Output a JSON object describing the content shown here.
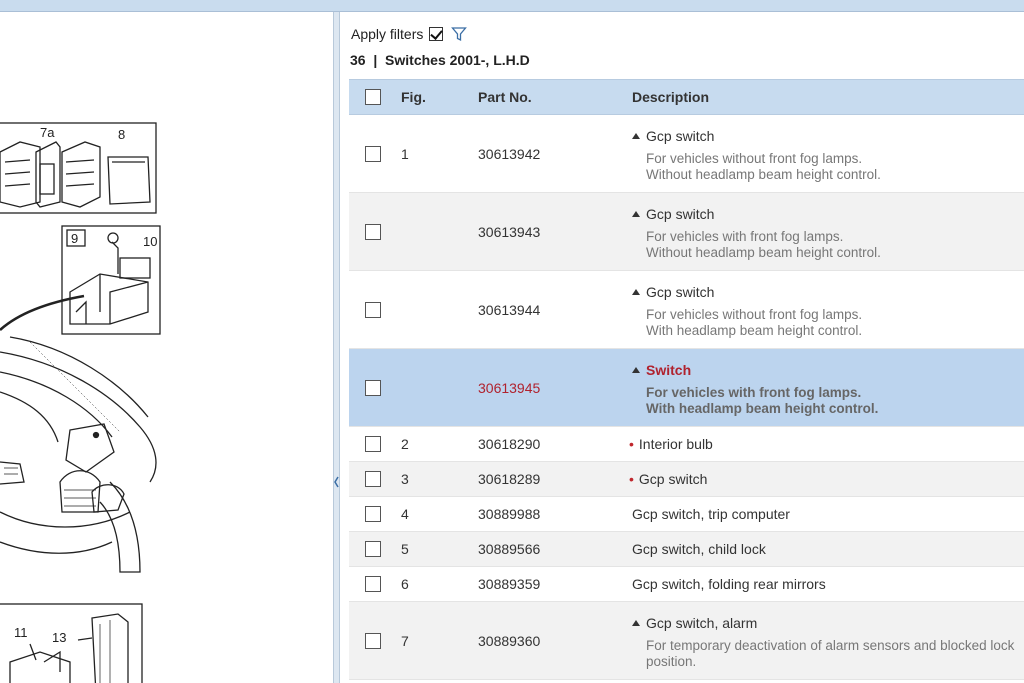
{
  "diagram": {
    "callouts": [
      "7a",
      "8",
      "9",
      "10",
      "11",
      "13"
    ]
  },
  "filters": {
    "label": "Apply filters",
    "checked": true,
    "funnel_icon": "funnel-icon"
  },
  "section": {
    "title": "36  |  Switches 2001-, L.H.D"
  },
  "table": {
    "headers": {
      "fig": "Fig.",
      "part": "Part No.",
      "desc": "Description"
    },
    "rows": [
      {
        "fig": "1",
        "part": "30613942",
        "title": "Gcp switch",
        "sub1": "For vehicles without front fog lamps.",
        "sub2": "Without headlamp beam height control."
      },
      {
        "fig": "",
        "part": "30613943",
        "title": "Gcp switch",
        "sub1": "For vehicles with front fog lamps.",
        "sub2": "Without headlamp beam height control."
      },
      {
        "fig": "",
        "part": "30613944",
        "title": "Gcp switch",
        "sub1": "For vehicles without front fog lamps.",
        "sub2": "With headlamp beam height control."
      },
      {
        "fig": "",
        "part": "30613945",
        "title": "Switch",
        "sub1": "For vehicles with front fog lamps.",
        "sub2": "With headlamp beam height control."
      },
      {
        "fig": "2",
        "part": "30618290",
        "title": "Interior bulb"
      },
      {
        "fig": "3",
        "part": "30618289",
        "title": "Gcp switch"
      },
      {
        "fig": "4",
        "part": "30889988",
        "title": "Gcp switch, trip computer"
      },
      {
        "fig": "5",
        "part": "30889566",
        "title": "Gcp switch, child lock"
      },
      {
        "fig": "6",
        "part": "30889359",
        "title": "Gcp switch, folding rear mirrors"
      },
      {
        "fig": "7",
        "part": "30889360",
        "title": "Gcp switch, alarm",
        "sub1": "For temporary deactivation of alarm sensors and blocked lock",
        "sub2": "position."
      }
    ]
  },
  "colors": {
    "header_bg": "#c7dbef",
    "selected_bg": "#bcd4ee",
    "highlight_red": "#b0222e"
  }
}
